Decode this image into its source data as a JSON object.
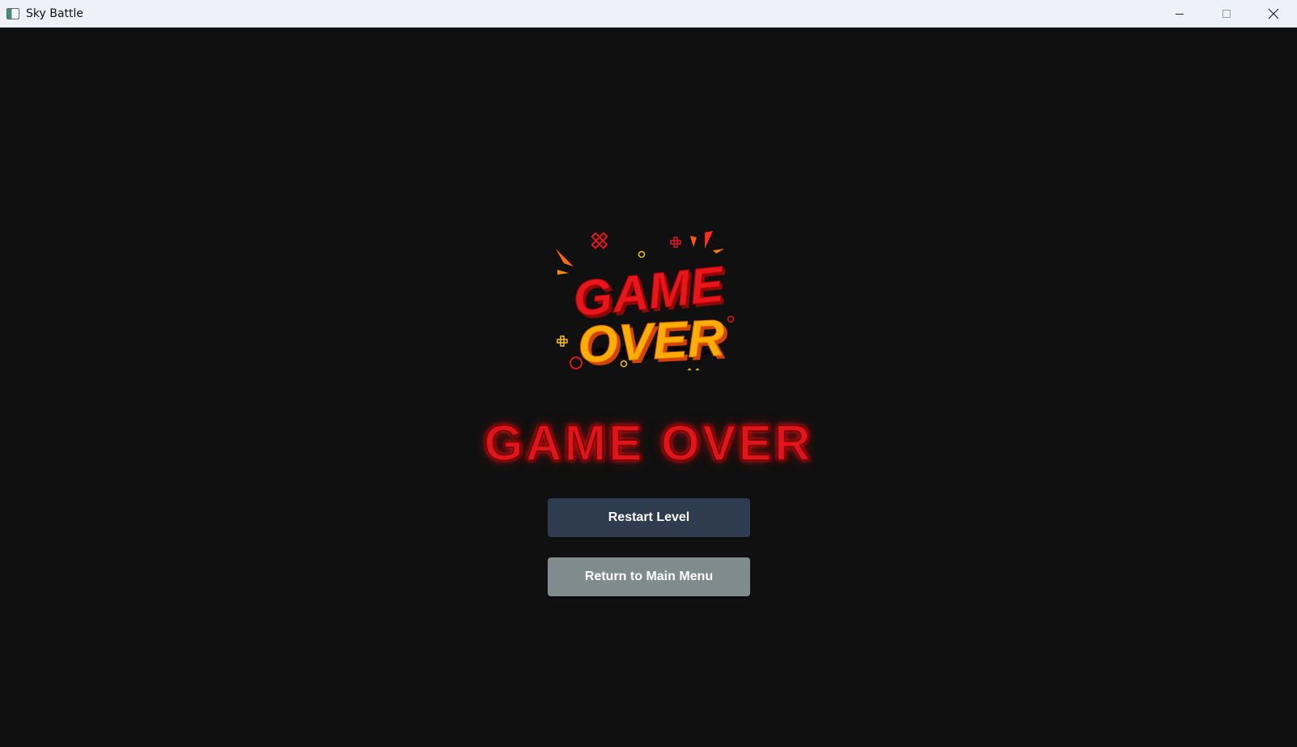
{
  "window": {
    "title": "Sky Battle",
    "controls": {
      "minimize_icon": "minimize-icon",
      "maximize_icon": "maximize-icon",
      "close_icon": "close-icon"
    }
  },
  "logo": {
    "line1": "GAME",
    "line2": "OVER",
    "colors": {
      "game": "#e8151a",
      "over": "#ffae00",
      "shadow": "#8a0a0a"
    }
  },
  "main": {
    "heading": "GAME OVER",
    "heading_color": "#e0141a",
    "buttons": {
      "restart": "Restart Level",
      "main_menu": "Return to Main Menu"
    },
    "button_colors": {
      "restart": "#2f3c50",
      "main_menu": "#7f8b8c"
    }
  }
}
